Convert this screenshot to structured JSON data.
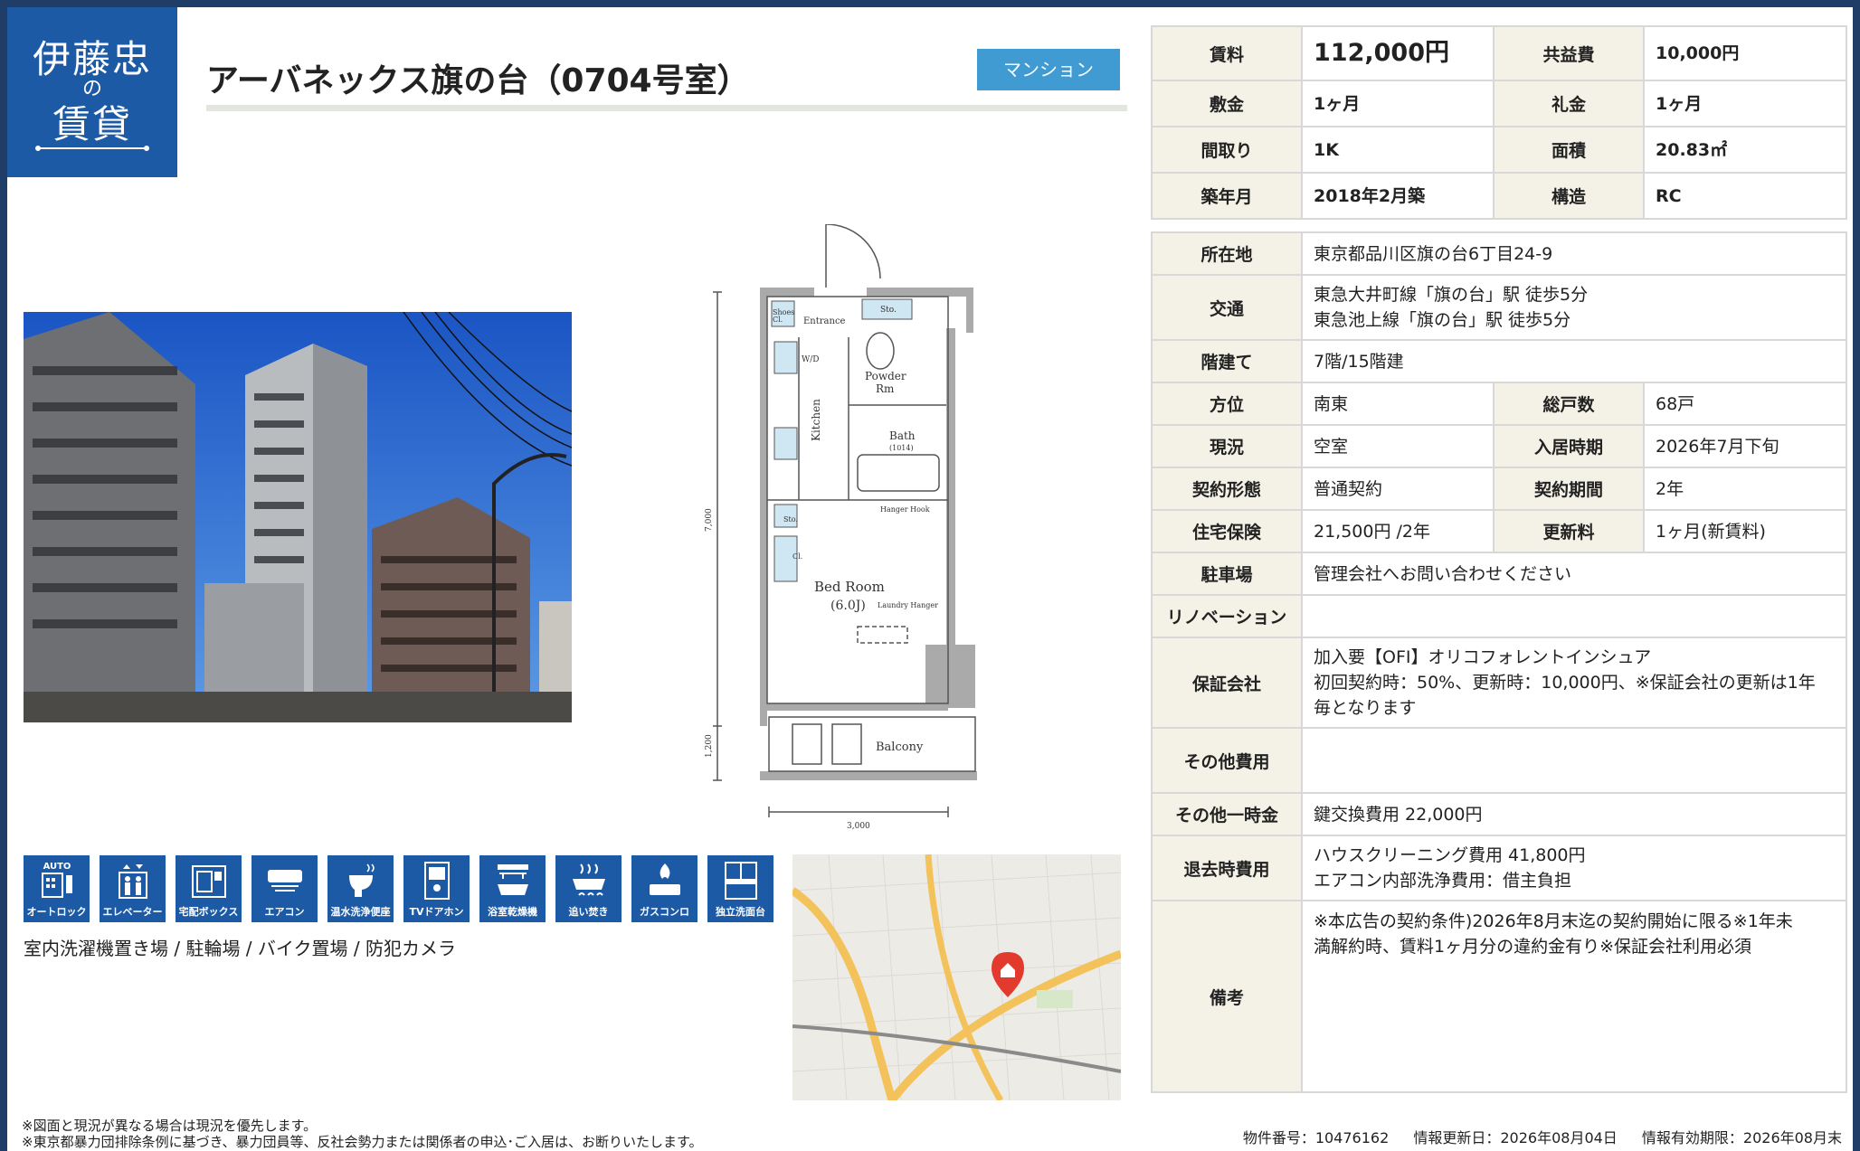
{
  "logo": {
    "line1": "伊藤忠",
    "line2": "の",
    "line3": "賃貸"
  },
  "property": {
    "title": "アーバネックス旗の台（0704号室）",
    "type_badge": "マンション"
  },
  "summary": {
    "rent_label": "賃料",
    "rent": "112,000円",
    "common_fee_label": "共益費",
    "common_fee": "10,000円",
    "deposit_label": "敷金",
    "deposit": "1ヶ月",
    "key_money_label": "礼金",
    "key_money": "1ヶ月",
    "layout_label": "間取り",
    "layout": "1K",
    "area_label": "面積",
    "area": "20.83㎡",
    "built_label": "築年月",
    "built": "2018年2月築",
    "structure_label": "構造",
    "structure": "RC"
  },
  "details": {
    "address_label": "所在地",
    "address": "東京都品川区旗の台6丁目24-9",
    "access_label": "交通",
    "access_1": "東急大井町線「旗の台」駅 徒歩5分",
    "access_2": "東急池上線「旗の台」駅 徒歩5分",
    "floor_label": "階建て",
    "floor": "7階/15階建",
    "direction_label": "方位",
    "direction": "南東",
    "units_label": "総戸数",
    "units": "68戸",
    "status_label": "現況",
    "status": "空室",
    "move_in_label": "入居時期",
    "move_in": "2026年7月下旬",
    "contract_type_label": "契約形態",
    "contract_type": "普通契約",
    "contract_period_label": "契約期間",
    "contract_period": "2年",
    "insurance_label": "住宅保険",
    "insurance": "21,500円 /2年",
    "renewal_label": "更新料",
    "renewal": "1ヶ月(新賃料)",
    "parking_label": "駐車場",
    "parking": "管理会社へお問い合わせください",
    "renovation_label": "リノベーション",
    "renovation": "",
    "guarantor_label": "保証会社",
    "guarantor_1": "加入要【OFI】オリコフォレントインシュア",
    "guarantor_2": "初回契約時：50%、更新時：10,000円、※保証会社の更新は1年",
    "guarantor_3": "毎となります",
    "other_fees_label": "その他費用",
    "other_fees": "",
    "one_time_label": "その他一時金",
    "one_time": "鍵交換費用 22,000円",
    "exit_fees_label": "退去時費用",
    "exit_fees_1": "ハウスクリーニング費用 41,800円",
    "exit_fees_2": "エアコン内部洗浄費用：借主負担",
    "remarks_label": "備考",
    "remarks_1": "※本広告の契約条件)2026年8月末迄の契約開始に限る※1年未",
    "remarks_2": "満解約時、賃料1ヶ月分の違約金有り※保証会社利用必須"
  },
  "amenities": [
    {
      "label": "オートロック",
      "icon": "auto-lock-icon",
      "top": "AUTO"
    },
    {
      "label": "エレベーター",
      "icon": "elevator-icon"
    },
    {
      "label": "宅配ボックス",
      "icon": "delivery-box-icon"
    },
    {
      "label": "エアコン",
      "icon": "air-conditioner-icon"
    },
    {
      "label": "温水洗浄便座",
      "icon": "toilet-icon"
    },
    {
      "label": "TVドアホン",
      "icon": "tv-intercom-icon"
    },
    {
      "label": "浴室乾燥機",
      "icon": "bath-dryer-icon"
    },
    {
      "label": "追い焚き",
      "icon": "reheat-bath-icon"
    },
    {
      "label": "ガスコンロ",
      "icon": "gas-stove-icon"
    },
    {
      "label": "独立洗面台",
      "icon": "washbasin-icon"
    }
  ],
  "other_amenities": "室内洗濯機置き場 / 駐輪場 / バイク置場 / 防犯カメラ",
  "floorplan": {
    "entrance": "Entrance",
    "shoes": "Shoes",
    "shoes2": "Cl.",
    "sto": "Sto.",
    "wd": "W/D",
    "kitchen": "Kitchen",
    "powder": "Powder",
    "powder2": "Rm",
    "bath": "Bath",
    "bath_size": "(1014)",
    "hanger": "Hanger Hook",
    "cl": "Cl.",
    "sto2": "Sto.",
    "bedroom": "Bed Room",
    "bedroom_size": "(6.0J)",
    "laundry": "Laundry Hanger",
    "balcony": "Balcony",
    "dim_height": "7,000",
    "dim_balcony": "1,200",
    "dim_width": "3,000"
  },
  "notes": {
    "line1": "※図面と現況が異なる場合は現況を優先します。",
    "line2": "※東京都暴力団排除条例に基づき、暴力団員等、反社会勢力または関係者の申込･ご入居は、お断りいたします。"
  },
  "footer": {
    "property_no": "物件番号：10476162",
    "updated": "情報更新日：2026年08月04日",
    "valid_until": "情報有効期限：2026年08月末"
  },
  "colors": {
    "brand": "#1c5aa6",
    "badge": "#3f9bd1",
    "label_bg": "#f4f2e7"
  }
}
